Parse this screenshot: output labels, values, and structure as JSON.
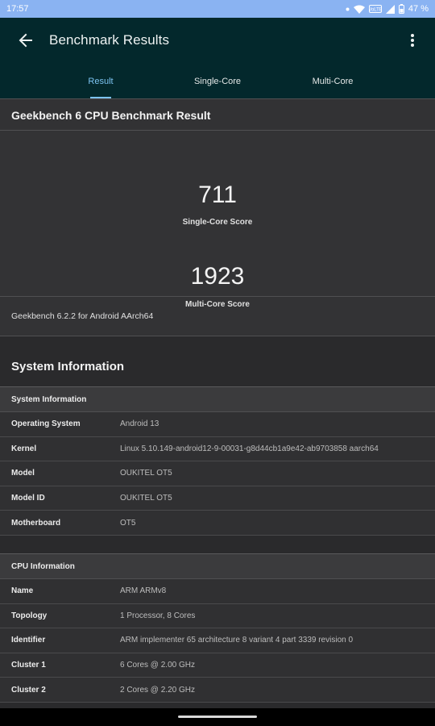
{
  "status_bar": {
    "time": "17:57",
    "battery_percent": "47 %",
    "icons": [
      "notification-dot-icon",
      "wifi-icon",
      "volte-icon",
      "signal-icon",
      "battery-icon"
    ]
  },
  "app_bar": {
    "title": "Benchmark Results",
    "back_icon": "arrow-left-icon",
    "menu_icon": "more-vertical-icon",
    "background_color": "#03282c"
  },
  "tabs": [
    {
      "label": "Result",
      "active": true
    },
    {
      "label": "Single-Core",
      "active": false
    },
    {
      "label": "Multi-Core",
      "active": false
    }
  ],
  "result": {
    "title": "Geekbench 6 CPU Benchmark Result",
    "single_core_score": "711",
    "single_core_label": "Single-Core Score",
    "multi_core_score": "1923",
    "multi_core_label": "Multi-Core Score",
    "version": "Geekbench 6.2.2 for Android AArch64"
  },
  "system_information": {
    "heading": "System Information",
    "table_title": "System Information",
    "rows": [
      {
        "key": "Operating System",
        "value": "Android 13"
      },
      {
        "key": "Kernel",
        "value": "Linux 5.10.149-android12-9-00031-g8d44cb1a9e42-ab9703858 aarch64"
      },
      {
        "key": "Model",
        "value": "OUKITEL OT5"
      },
      {
        "key": "Model ID",
        "value": "OUKITEL OT5"
      },
      {
        "key": "Motherboard",
        "value": "OT5"
      }
    ]
  },
  "cpu_information": {
    "table_title": "CPU Information",
    "rows": [
      {
        "key": "Name",
        "value": "ARM ARMv8"
      },
      {
        "key": "Topology",
        "value": "1 Processor, 8 Cores"
      },
      {
        "key": "Identifier",
        "value": "ARM implementer 65 architecture 8 variant 4 part 3339 revision 0"
      },
      {
        "key": "Cluster 1",
        "value": "6 Cores @ 2.00 GHz"
      },
      {
        "key": "Cluster 2",
        "value": "2 Cores @ 2.20 GHz"
      }
    ]
  },
  "colors": {
    "accent": "#7cc3f1",
    "status_bar": "#8ab3f2"
  }
}
